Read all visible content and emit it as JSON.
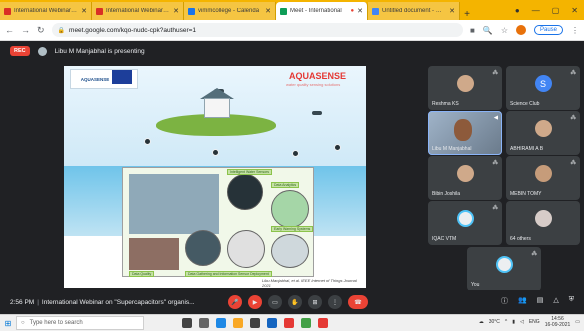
{
  "browser": {
    "tabs": [
      {
        "title": "International Webinar Inv",
        "icon": "gmail-icon",
        "color": "#d93025",
        "active": false
      },
      {
        "title": "International Webinar on",
        "icon": "gmail-icon",
        "color": "#d93025",
        "active": false
      },
      {
        "title": "vimmcollege - Calenda",
        "icon": "calendar-icon",
        "color": "#1a73e8",
        "active": false
      },
      {
        "title": "Meet - International",
        "icon": "meet-icon",
        "color": "#0f9d58",
        "active": true
      },
      {
        "title": "Untitled document - Goo",
        "icon": "docs-icon",
        "color": "#4285f4",
        "active": false
      }
    ],
    "new_tab": "+",
    "url": "meet.google.com/kqo-nudc-cpk?authuser=1",
    "pause_label": "Pause"
  },
  "presenting": {
    "rec_label": "REC",
    "text": "Libu M Manjabhal is presenting"
  },
  "slide": {
    "logo_text": "AQUASENSE",
    "title": "AQUASENSE",
    "subtitle": "water quality sensing solutions",
    "labels": [
      "Intelligent Water Sensors",
      "Data Analytics",
      "Early Warning Systems",
      "Data Quality",
      "Data Gathering and Information Sensor Deployment"
    ],
    "citation": "Libu Manjabhal, et al. IEEE Internet of Things Journal 2021"
  },
  "participants": [
    {
      "name": "Reshma KS",
      "avatar": "photo",
      "mic": "muted"
    },
    {
      "name": "Science Club",
      "avatar": "S",
      "mic": "muted"
    },
    {
      "name": "Libu M Manjabhal",
      "avatar": "video",
      "mic": "active"
    },
    {
      "name": "ABHIRAMI A B",
      "avatar": "photo",
      "mic": "muted"
    },
    {
      "name": "Bibin Joshila",
      "avatar": "photo",
      "mic": "muted"
    },
    {
      "name": "MEBIN TOMY",
      "avatar": "photo",
      "mic": "muted"
    },
    {
      "name": "IQAC VTM",
      "avatar": "ring",
      "mic": "muted"
    },
    {
      "name": "64 others",
      "avatar": "group",
      "mic": "none"
    },
    {
      "name": "You",
      "avatar": "ring",
      "mic": "muted"
    }
  ],
  "meeting": {
    "time": "2:56 PM",
    "title": "International Webinar on \"Supercapacitors\" organis..."
  },
  "taskbar": {
    "search_placeholder": "Type here to search",
    "temperature": "30°C",
    "lang": "ENG",
    "time": "14:56",
    "date": "16-09-2021"
  }
}
